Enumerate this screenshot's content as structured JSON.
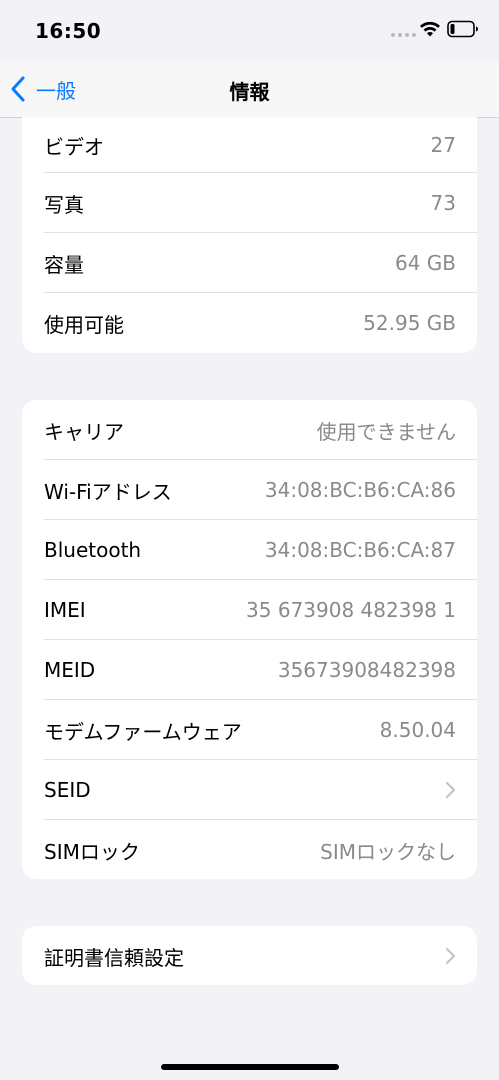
{
  "status_bar": {
    "time": "16:50",
    "icons": [
      "signal-dots-icon",
      "wifi-icon",
      "battery-icon"
    ]
  },
  "nav": {
    "back_label": "一般",
    "back_icon": "chevron-left-icon",
    "title": "情報",
    "accent_color": "#0A7AFF"
  },
  "groups": [
    {
      "rows": [
        {
          "label": "ビデオ",
          "value": "27"
        },
        {
          "label": "写真",
          "value": "73"
        },
        {
          "label": "容量",
          "value": "64 GB"
        },
        {
          "label": "使用可能",
          "value": "52.95 GB"
        }
      ]
    },
    {
      "rows": [
        {
          "label": "キャリア",
          "value": "使用できません"
        },
        {
          "label": "Wi-Fiアドレス",
          "value": "34:08:BC:B6:CA:86"
        },
        {
          "label": "Bluetooth",
          "value": "34:08:BC:B6:CA:87"
        },
        {
          "label": "IMEI",
          "value": "35 673908 482398 1"
        },
        {
          "label": "MEID",
          "value": "35673908482398"
        },
        {
          "label": "モデムファームウェア",
          "value": "8.50.04"
        },
        {
          "label": "SEID",
          "value": "",
          "icon": "chevron-right-icon"
        },
        {
          "label": "SIMロック",
          "value": "SIMロックなし"
        }
      ]
    },
    {
      "rows": [
        {
          "label": "証明書信頼設定",
          "value": "",
          "icon": "chevron-right-icon"
        }
      ]
    }
  ]
}
